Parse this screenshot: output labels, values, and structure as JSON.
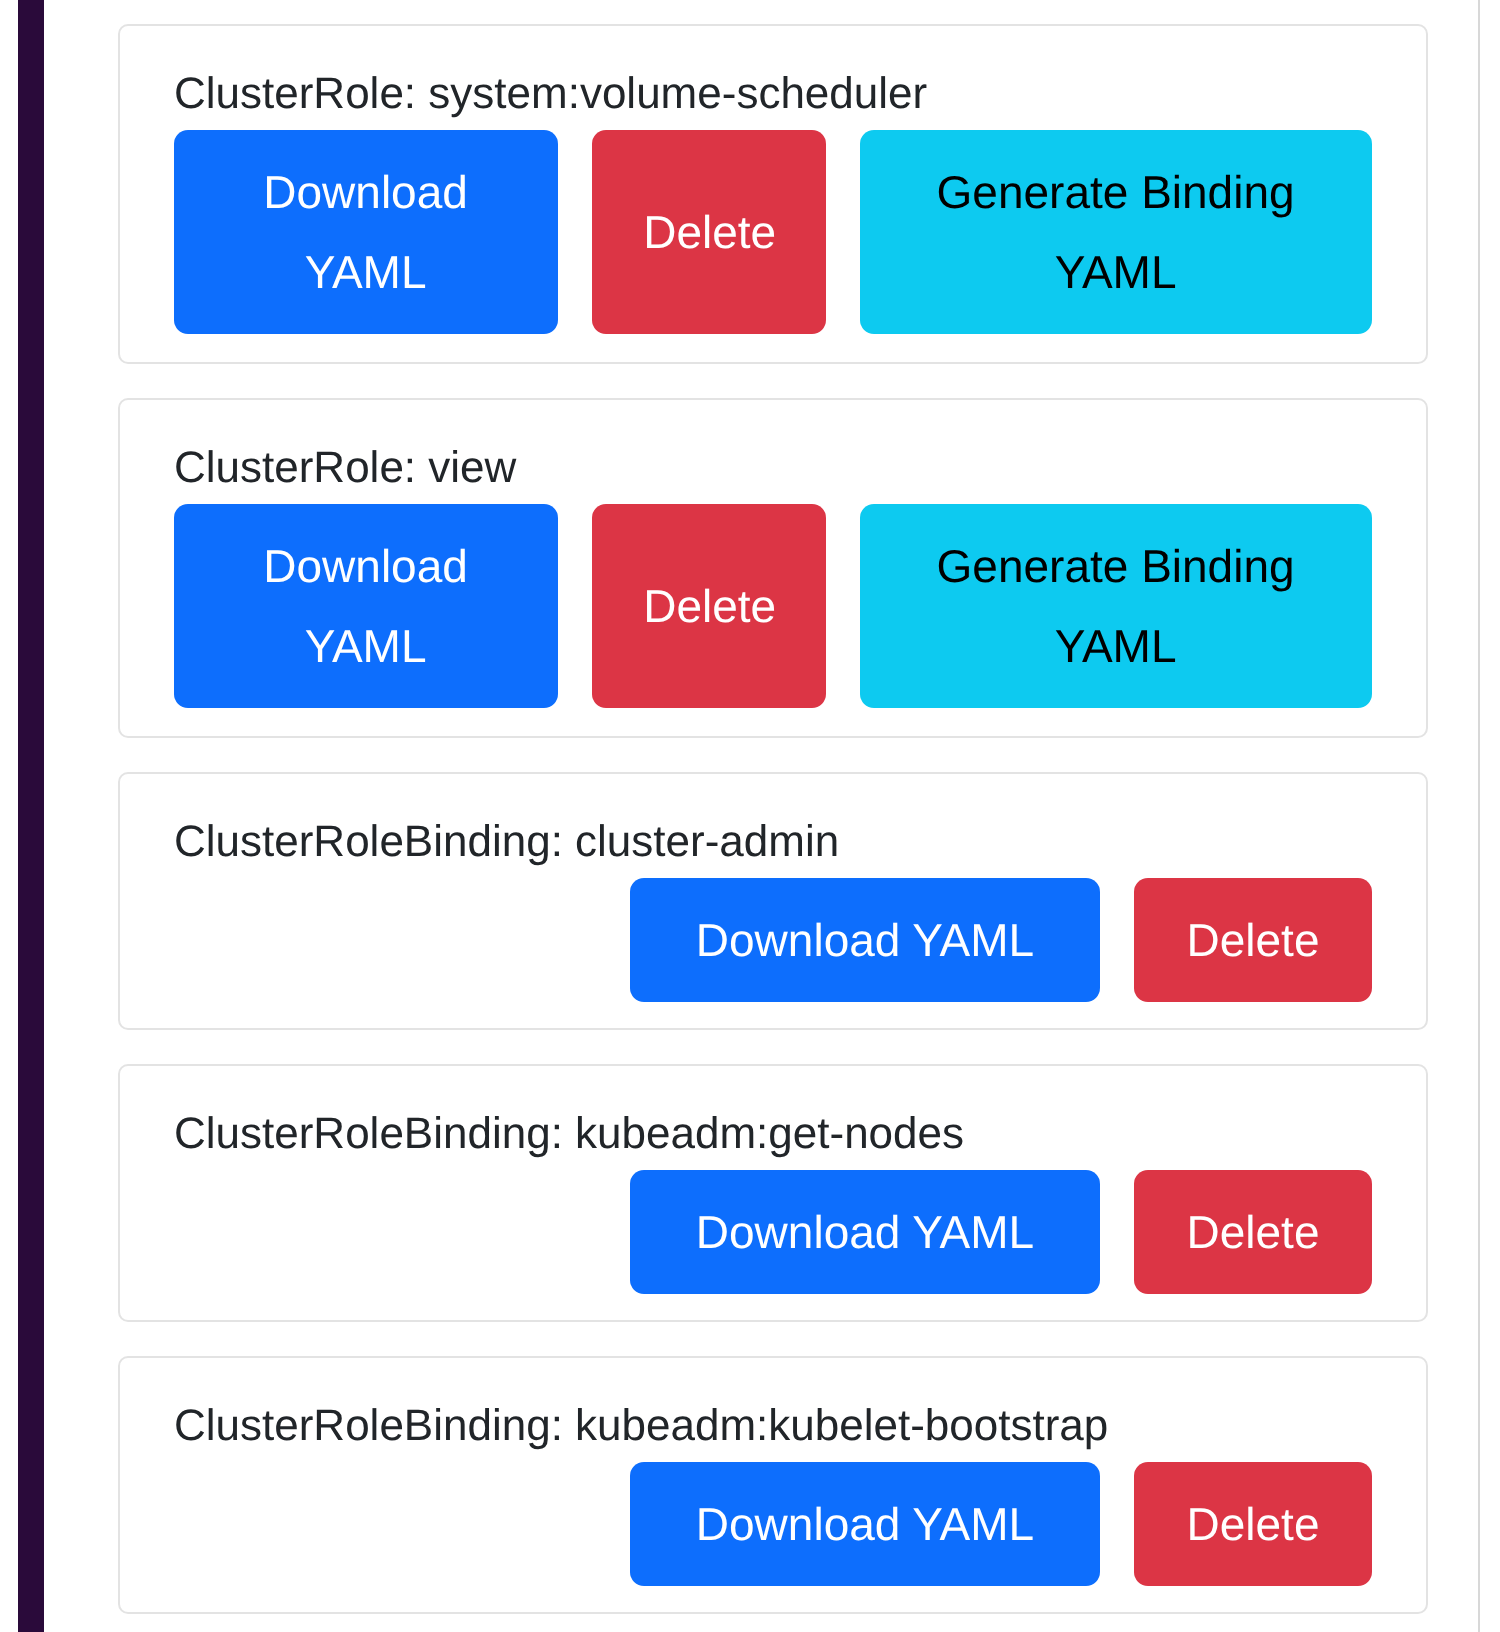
{
  "resources": [
    {
      "kind": "role",
      "title": "ClusterRole: system:volume-scheduler",
      "buttons": [
        {
          "label": "Download YAML",
          "kind": "download"
        },
        {
          "label": "Delete",
          "kind": "delete"
        },
        {
          "label": "Generate Binding YAML",
          "kind": "generate"
        }
      ]
    },
    {
      "kind": "role",
      "title": "ClusterRole: view",
      "buttons": [
        {
          "label": "Download YAML",
          "kind": "download"
        },
        {
          "label": "Delete",
          "kind": "delete"
        },
        {
          "label": "Generate Binding YAML",
          "kind": "generate"
        }
      ]
    },
    {
      "kind": "binding",
      "title": "ClusterRoleBinding: cluster-admin",
      "buttons": [
        {
          "label": "Download YAML",
          "kind": "download"
        },
        {
          "label": "Delete",
          "kind": "delete"
        }
      ]
    },
    {
      "kind": "binding",
      "title": "ClusterRoleBinding: kubeadm:get-nodes",
      "buttons": [
        {
          "label": "Download YAML",
          "kind": "download"
        },
        {
          "label": "Delete",
          "kind": "delete"
        }
      ]
    },
    {
      "kind": "binding",
      "title": "ClusterRoleBinding: kubeadm:kubelet-bootstrap",
      "buttons": [
        {
          "label": "Download YAML",
          "kind": "download"
        },
        {
          "label": "Delete",
          "kind": "delete"
        }
      ]
    }
  ]
}
